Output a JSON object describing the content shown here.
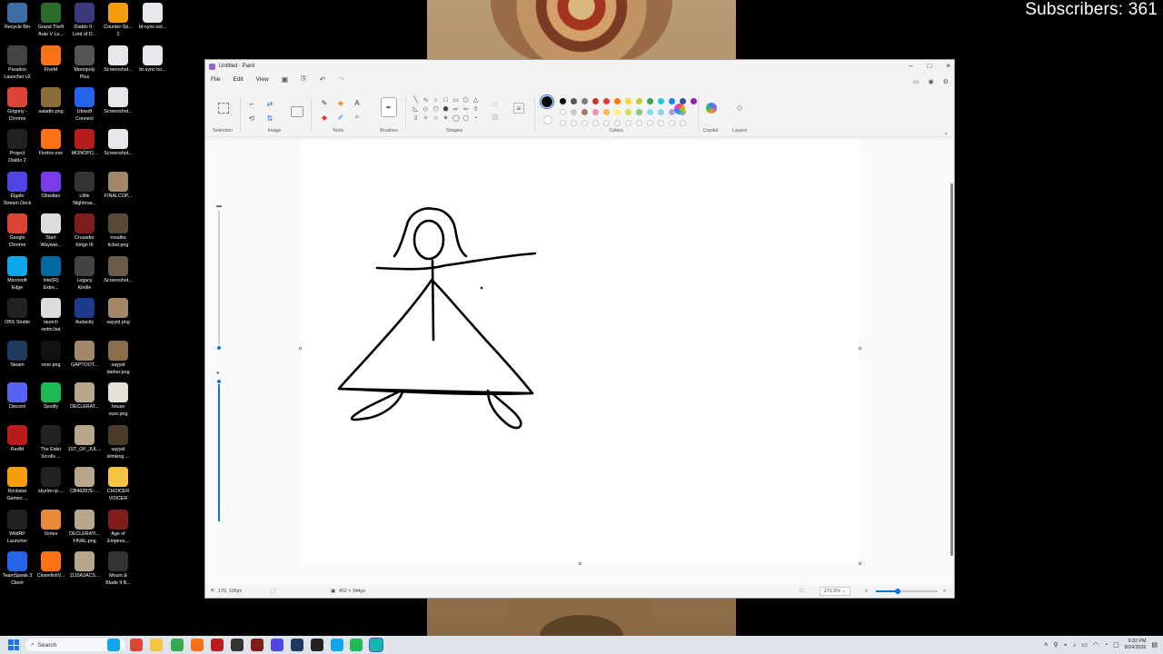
{
  "overlay": {
    "subscribers": "Subscribers: 361"
  },
  "desktop": {
    "icons": [
      {
        "label": "Recycle Bin",
        "icon": "recycle-bin-icon",
        "color": "#3b6ea5"
      },
      {
        "label": "Grand Theft\nAuto V Le...",
        "icon": "gta-icon",
        "color": "#2b6b2b"
      },
      {
        "label": "Diablo II -\nLord of D...",
        "icon": "diablo-icon",
        "color": "#3a3a7a"
      },
      {
        "label": "Counter-Str...\n2",
        "icon": "cs2-icon",
        "color": "#f59e0b"
      },
      {
        "label": "bt-sync-sol...",
        "icon": "document-icon",
        "color": "#e5e7eb"
      },
      {
        "label": "Paradox\nLauncher v2",
        "icon": "paradox-icon",
        "color": "#444"
      },
      {
        "label": "FiveM",
        "icon": "fivem-icon",
        "color": "#f97316"
      },
      {
        "label": "Monopoly\nPlus",
        "icon": "monopoly-icon",
        "color": "#555"
      },
      {
        "label": "Screenshot...",
        "icon": "image-file-icon",
        "color": "#e5e7eb"
      },
      {
        "label": "bt-sync-ho...",
        "icon": "document-icon",
        "color": "#e5e7eb"
      },
      {
        "label": "Grigoriy -\nChrome",
        "icon": "chrome-icon",
        "color": "#db4437"
      },
      {
        "label": "saladin.png",
        "icon": "image-file-icon",
        "color": "#8a6d3b"
      },
      {
        "label": "Ubisoft\nConnect",
        "icon": "ubisoft-icon",
        "color": "#2563eb"
      },
      {
        "label": "Screenshot...",
        "icon": "image-file-icon",
        "color": "#e5e7eb"
      },
      {
        "label": "Project\nDiablo 2",
        "icon": "pd2-icon",
        "color": "#222"
      },
      {
        "label": "Firefox.exe",
        "icon": "firefox-icon",
        "color": "#f97316"
      },
      {
        "label": "MONOPO...",
        "icon": "monopoly-icon",
        "color": "#b91c1c"
      },
      {
        "label": "Screenshot...",
        "icon": "image-file-icon",
        "color": "#e5e7eb"
      },
      {
        "label": "Elgato\nStream Deck",
        "icon": "stream-deck-icon",
        "color": "#4f46e5"
      },
      {
        "label": "Obsidian",
        "icon": "obsidian-icon",
        "color": "#7c3aed"
      },
      {
        "label": "Little\nNightmar...",
        "icon": "little-nightmares-icon",
        "color": "#333"
      },
      {
        "label": "FINALCOP...",
        "icon": "image-file-icon",
        "color": "#a08868"
      },
      {
        "label": "Google\nChrome",
        "icon": "chrome-icon",
        "color": "#db4437"
      },
      {
        "label": "Start\nWaywar...",
        "icon": "shortcut-icon",
        "color": "#ddd"
      },
      {
        "label": "Crusader\nKings III",
        "icon": "ck3-icon",
        "color": "#7f1d1d"
      },
      {
        "label": "rosalita\nticket.png",
        "icon": "image-file-icon",
        "color": "#5a4a3a"
      },
      {
        "label": "Microsoft\nEdge",
        "icon": "edge-icon",
        "color": "#0ea5e9"
      },
      {
        "label": "Intel(R)\nExtre...",
        "icon": "intel-icon",
        "color": "#0369a1"
      },
      {
        "label": "Legacy\nKindle",
        "icon": "kindle-icon",
        "color": "#444"
      },
      {
        "label": "Screenshot...",
        "icon": "image-file-icon",
        "color": "#6b5b4b"
      },
      {
        "label": "OBS Studio",
        "icon": "obs-icon",
        "color": "#222"
      },
      {
        "label": "launch\nredm.bat",
        "icon": "batch-file-icon",
        "color": "#ddd"
      },
      {
        "label": "Audacity",
        "icon": "audacity-icon",
        "color": "#1e3a8a"
      },
      {
        "label": "sayyid.png",
        "icon": "image-file-icon",
        "color": "#a08868"
      },
      {
        "label": "Steam",
        "icon": "steam-icon",
        "color": "#1e3a5f"
      },
      {
        "label": "rene.png",
        "icon": "image-file-icon",
        "color": "#111"
      },
      {
        "label": "GAPTOOT...",
        "icon": "image-file-icon",
        "color": "#a08868"
      },
      {
        "label": "sayyid\ndarker.png",
        "icon": "image-file-icon",
        "color": "#8a6d4b"
      },
      {
        "label": "Discord",
        "icon": "discord-icon",
        "color": "#5865f2"
      },
      {
        "label": "Spotify",
        "icon": "spotify-icon",
        "color": "#1db954"
      },
      {
        "label": "DECLERAT...",
        "icon": "image-file-icon",
        "color": "#b8a68a"
      },
      {
        "label": "house\noure.png",
        "icon": "image-file-icon",
        "color": "#e5e0d5"
      },
      {
        "label": "RedM",
        "icon": "redm-icon",
        "color": "#b91c1c"
      },
      {
        "label": "The Elder\nScrolls ...",
        "icon": "elder-scrolls-icon",
        "color": "#222"
      },
      {
        "label": "1ST_OF_JUL...",
        "icon": "image-file-icon",
        "color": "#b8a68a"
      },
      {
        "label": "sayyid\ndrinking ...",
        "icon": "image-file-icon",
        "color": "#4a3a2a"
      },
      {
        "label": "Rockstar\nGames ...",
        "icon": "rockstar-icon",
        "color": "#f59e0b"
      },
      {
        "label": "skyrim-rp-...",
        "icon": "skyrim-icon",
        "color": "#222"
      },
      {
        "label": "CB46287E-...",
        "icon": "image-file-icon",
        "color": "#b8a68a"
      },
      {
        "label": "CHOICER\nVOICER",
        "icon": "folder-icon",
        "color": "#f5c542"
      },
      {
        "label": "WildRP\nLauncher",
        "icon": "wildrp-icon",
        "color": "#222"
      },
      {
        "label": "Vortex",
        "icon": "vortex-icon",
        "color": "#e88a3a"
      },
      {
        "label": "DECLERATI...\nFINAL.png",
        "icon": "image-file-icon",
        "color": "#b8a68a"
      },
      {
        "label": "Age of\nEmpires...",
        "icon": "aoe-icon",
        "color": "#7f1d1d"
      },
      {
        "label": "TeamSpeak 3\nClient",
        "icon": "teamspeak-icon",
        "color": "#2563eb"
      },
      {
        "label": "ClownfishV...",
        "icon": "clownfish-icon",
        "color": "#f97316"
      },
      {
        "label": "1110A3ACS...",
        "icon": "image-file-icon",
        "color": "#b8a68a"
      },
      {
        "label": "Mount &\nBlade II B...",
        "icon": "bannerlord-icon",
        "color": "#333"
      }
    ]
  },
  "paint": {
    "title": "Untitled - Paint",
    "menu": {
      "file": "File",
      "edit": "Edit",
      "view": "View"
    },
    "groups": {
      "selection": "Selection",
      "image": "Image",
      "tools": "Tools",
      "brushes": "Brushes",
      "shapes": "Shapes",
      "colors": "Colors",
      "copilot": "Copilot",
      "layers": "Layers"
    },
    "palette": [
      "#000000",
      "#555555",
      "#7a7a7a",
      "#c0392b",
      "#e53935",
      "#f57c00",
      "#fdd835",
      "#c0ca33",
      "#43a047",
      "#26c6da",
      "#1e88e5",
      "#3949ab",
      "#8e24aa"
    ],
    "palette_row2": [
      "#ffffff",
      "#c8c8c8",
      "#9e7b62",
      "#f48fb1",
      "#ffb74d",
      "#fff176",
      "#d4e157",
      "#81c784",
      "#80deea",
      "#90caf9",
      "#9fa8da",
      "#ce93d8"
    ],
    "status": {
      "cursor": "170, 106px",
      "canvas_size": "452 × 344px",
      "zoom": "271.5%"
    }
  },
  "taskbar": {
    "search_placeholder": "Search",
    "time": "9:32 PM",
    "date": "8/24/2026",
    "apps": [
      {
        "icon": "browser-icon",
        "color": "#0ea5e9"
      },
      {
        "icon": "chrome-icon",
        "color": "#db4437"
      },
      {
        "icon": "file-explorer-icon",
        "color": "#f5c542"
      },
      {
        "icon": "chrome-icon",
        "color": "#34a853"
      },
      {
        "icon": "firefox-icon",
        "color": "#f97316"
      },
      {
        "icon": "redm-icon",
        "color": "#b91c1c"
      },
      {
        "icon": "terminal-icon",
        "color": "#333"
      },
      {
        "icon": "ck3-icon",
        "color": "#7f1d1d"
      },
      {
        "icon": "stream-deck-icon",
        "color": "#4f46e5"
      },
      {
        "icon": "steam-icon",
        "color": "#1e3a5f"
      },
      {
        "icon": "obs-icon",
        "color": "#222"
      },
      {
        "icon": "calculator-icon",
        "color": "#0ea5e9"
      },
      {
        "icon": "spotify-icon",
        "color": "#1db954"
      },
      {
        "icon": "paint-icon",
        "color": "#14b8a6"
      }
    ]
  }
}
